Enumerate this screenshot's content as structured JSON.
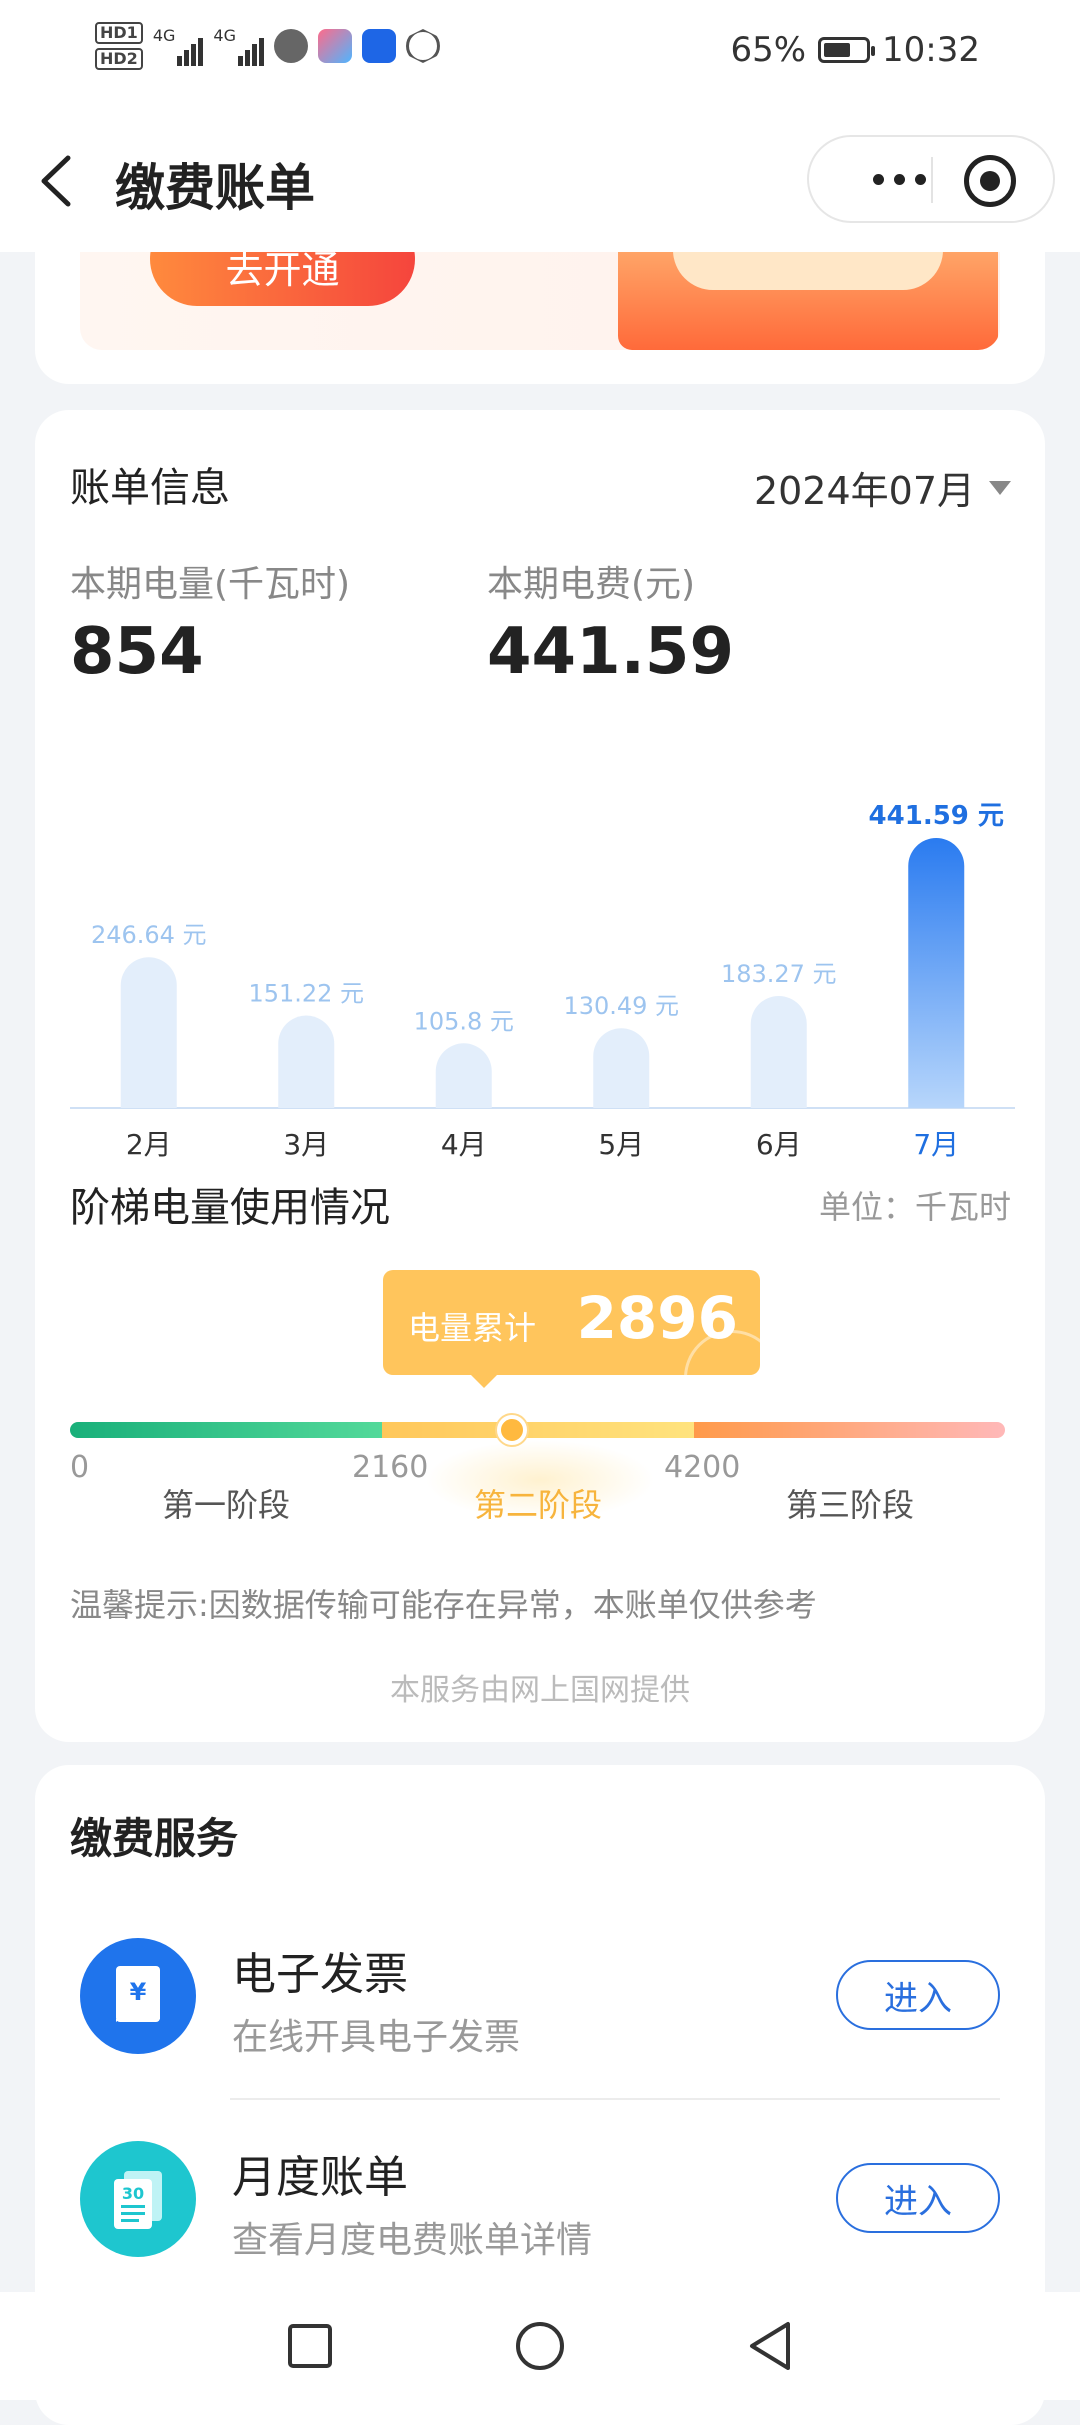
{
  "status_bar": {
    "hd1": "HD1",
    "hd2": "HD2",
    "net1": "4G",
    "net2": "4G",
    "battery": "65%",
    "time": "10:32",
    "app_icons": [
      "sound-wave-icon",
      "app-store-icon",
      "bulb-icon",
      "hand-icon"
    ]
  },
  "header": {
    "title": "缴费账单",
    "back_icon": "chevron-left-icon",
    "more_icon": "more-dots-icon",
    "close_icon": "target-icon"
  },
  "banner": {
    "button_label": "去开通"
  },
  "bill": {
    "title": "账单信息",
    "month": "2024年07月",
    "usage_label": "本期电量(千瓦时)",
    "usage_value": "854",
    "fee_label": "本期电费(元)",
    "fee_value": "441.59"
  },
  "chart_data": {
    "type": "bar",
    "categories": [
      "2月",
      "3月",
      "4月",
      "5月",
      "6月",
      "7月"
    ],
    "values": [
      246.64,
      151.22,
      105.8,
      130.49,
      183.27,
      441.59
    ],
    "value_labels": [
      "246.64 元",
      "151.22 元",
      "105.8 元",
      "130.49 元",
      "183.27 元",
      "441.59 元"
    ],
    "highlight_index": 5,
    "colors": {
      "normal": "#e3eefb",
      "normal_label": "#9dc4ef",
      "highlight_top": "#2a7bf0",
      "highlight_bottom": "#b7d6fb",
      "highlight_label": "#1f6fe0",
      "axis": "#cfe0f5"
    }
  },
  "tier": {
    "title": "阶梯电量使用情况",
    "unit": "单位：千瓦时",
    "tip_label": "电量累计",
    "tip_value": "2896",
    "ticks": [
      "0",
      "2160",
      "4200"
    ],
    "stages": [
      "第一阶段",
      "第二阶段",
      "第三阶段"
    ],
    "active_stage": 1,
    "position_fraction": 0.473
  },
  "notice": "温馨提示:因数据传输可能存在异常，本账单仅供参考",
  "provider": "本服务由网上国网提供",
  "services": {
    "title": "缴费服务",
    "items": [
      {
        "name": "电子发票",
        "desc": "在线开具电子发票",
        "button": "进入",
        "icon": "invoice-yuan-icon",
        "color": "#1f74ec"
      },
      {
        "name": "月度账单",
        "desc": "查看月度电费账单详情",
        "button": "进入",
        "icon": "monthly-bill-icon",
        "color": "#1ec6cf"
      }
    ]
  },
  "nav": {
    "items": [
      "recent-apps-icon",
      "home-icon",
      "back-icon"
    ]
  }
}
